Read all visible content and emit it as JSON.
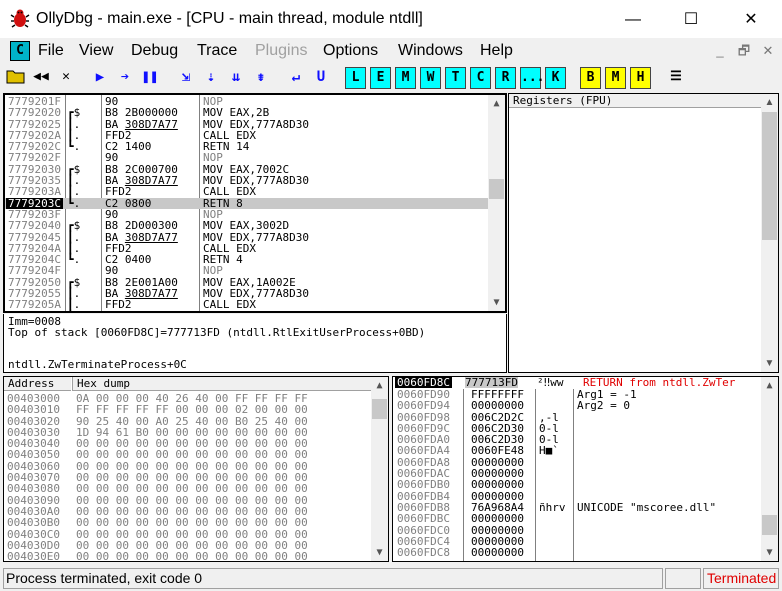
{
  "window": {
    "title": "OllyDbg - main.exe - [CPU - main thread, module ntdll]",
    "minimize": "—",
    "maximize": "☐",
    "close": "✕"
  },
  "menu": {
    "c_icon": "C",
    "items": [
      "File",
      "View",
      "Debug",
      "Trace",
      "Plugins",
      "Options",
      "Windows",
      "Help"
    ],
    "disabled": [
      "Plugins"
    ],
    "mdi": [
      "_",
      "🗗",
      "✕"
    ]
  },
  "toolbar": {
    "letters": [
      "L",
      "E",
      "M",
      "W",
      "T",
      "C",
      "R",
      "...",
      "K"
    ],
    "yellow": [
      "B",
      "M",
      "H"
    ]
  },
  "disasm": {
    "rows": [
      {
        "addr": "7779201F",
        "brace": "",
        "hex": "90",
        "cmd": "NOP",
        "nop": true
      },
      {
        "addr": "77792020",
        "brace": "┏$",
        "hex": "B8 2B000000",
        "cmd": "MOV EAX,2B"
      },
      {
        "addr": "77792025",
        "brace": "┃.",
        "hex": "BA 308D7A77",
        "cmd": "MOV EDX,777A8D30",
        "ul": true
      },
      {
        "addr": "7779202A",
        "brace": "┃.",
        "hex": "FFD2",
        "cmd": "CALL EDX"
      },
      {
        "addr": "7779202C",
        "brace": "┗.",
        "hex": "C2 1400",
        "cmd": "RETN 14"
      },
      {
        "addr": "7779202F",
        "brace": "",
        "hex": "90",
        "cmd": "NOP",
        "nop": true
      },
      {
        "addr": "77792030",
        "brace": "┏$",
        "hex": "B8 2C000700",
        "cmd": "MOV EAX,7002C"
      },
      {
        "addr": "77792035",
        "brace": "┃.",
        "hex": "BA 308D7A77",
        "cmd": "MOV EDX,777A8D30",
        "ul": true
      },
      {
        "addr": "7779203A",
        "brace": "┃.",
        "hex": "FFD2",
        "cmd": "CALL EDX"
      },
      {
        "addr": "7779203C",
        "brace": "┗.",
        "hex": "C2 0800",
        "cmd": "RETN 8",
        "sel": true
      },
      {
        "addr": "7779203F",
        "brace": "",
        "hex": "90",
        "cmd": "NOP",
        "nop": true
      },
      {
        "addr": "77792040",
        "brace": "┏$",
        "hex": "B8 2D000300",
        "cmd": "MOV EAX,3002D"
      },
      {
        "addr": "77792045",
        "brace": "┃.",
        "hex": "BA 308D7A77",
        "cmd": "MOV EDX,777A8D30",
        "ul": true
      },
      {
        "addr": "7779204A",
        "brace": "┃.",
        "hex": "FFD2",
        "cmd": "CALL EDX"
      },
      {
        "addr": "7779204C",
        "brace": "┗.",
        "hex": "C2 0400",
        "cmd": "RETN 4"
      },
      {
        "addr": "7779204F",
        "brace": "",
        "hex": "90",
        "cmd": "NOP",
        "nop": true
      },
      {
        "addr": "77792050",
        "brace": "┏$",
        "hex": "B8 2E001A00",
        "cmd": "MOV EAX,1A002E"
      },
      {
        "addr": "77792055",
        "brace": "┃.",
        "hex": "BA 308D7A77",
        "cmd": "MOV EDX,777A8D30",
        "ul": true
      },
      {
        "addr": "7779205A",
        "brace": "┃.",
        "hex": "FFD2",
        "cmd": "CALL EDX"
      },
      {
        "addr": "7779205C",
        "brace": "┗.",
        "hex": "C2 0400",
        "cmd": "RETN 4"
      }
    ]
  },
  "registers": {
    "header": "Registers (FPU)"
  },
  "info": {
    "line1": "Imm=0008",
    "line2": "Top of stack [0060FD8C]=777713FD (ntdll.RtlExitUserProcess+0BD)",
    "line3": "ntdll.ZwTerminateProcess+0C"
  },
  "dump": {
    "header_address": "Address",
    "header_hex": "Hex dump",
    "rows": [
      {
        "addr": "00403000",
        "hex": "0A 00 00 00 40 26 40 00 FF FF FF FF"
      },
      {
        "addr": "00403010",
        "hex": "FF FF FF FF FF 00 00 00 02 00 00 00"
      },
      {
        "addr": "00403020",
        "hex": "90 25 40 00 A0 25 40 00 B0 25 40 00"
      },
      {
        "addr": "00403030",
        "hex": "1D 94 61 B0 00 00 00 00 00 00 00 00"
      },
      {
        "addr": "00403040",
        "hex": "00 00 00 00 00 00 00 00 00 00 00 00"
      },
      {
        "addr": "00403050",
        "hex": "00 00 00 00 00 00 00 00 00 00 00 00"
      },
      {
        "addr": "00403060",
        "hex": "00 00 00 00 00 00 00 00 00 00 00 00"
      },
      {
        "addr": "00403070",
        "hex": "00 00 00 00 00 00 00 00 00 00 00 00"
      },
      {
        "addr": "00403080",
        "hex": "00 00 00 00 00 00 00 00 00 00 00 00"
      },
      {
        "addr": "00403090",
        "hex": "00 00 00 00 00 00 00 00 00 00 00 00"
      },
      {
        "addr": "004030A0",
        "hex": "00 00 00 00 00 00 00 00 00 00 00 00"
      },
      {
        "addr": "004030B0",
        "hex": "00 00 00 00 00 00 00 00 00 00 00 00"
      },
      {
        "addr": "004030C0",
        "hex": "00 00 00 00 00 00 00 00 00 00 00 00"
      },
      {
        "addr": "004030D0",
        "hex": "00 00 00 00 00 00 00 00 00 00 00 00"
      },
      {
        "addr": "004030E0",
        "hex": "00 00 00 00 00 00 00 00 00 00 00 00"
      }
    ]
  },
  "stack": {
    "header_addr": "0060FD8C",
    "header_val": "777713FD",
    "header_ascii": "²‼ww",
    "header_comment": "RETURN from ntdll.ZwTer",
    "rows": [
      {
        "addr": "0060FD90",
        "val": "FFFFFFFF",
        "ascii": "",
        "comment": "Arg1 = -1"
      },
      {
        "addr": "0060FD94",
        "val": "00000000",
        "ascii": "",
        "comment": "Arg2 = 0"
      },
      {
        "addr": "0060FD98",
        "val": "006C2D2C",
        "ascii": ",-l",
        "comment": ""
      },
      {
        "addr": "0060FD9C",
        "val": "006C2D30",
        "ascii": "0-l",
        "comment": ""
      },
      {
        "addr": "0060FDA0",
        "val": "006C2D30",
        "ascii": "0-l",
        "comment": ""
      },
      {
        "addr": "0060FDA4",
        "val": "0060FE48",
        "ascii": "H■`",
        "comment": ""
      },
      {
        "addr": "0060FDA8",
        "val": "00000000",
        "ascii": "",
        "comment": ""
      },
      {
        "addr": "0060FDAC",
        "val": "00000000",
        "ascii": "",
        "comment": ""
      },
      {
        "addr": "0060FDB0",
        "val": "00000000",
        "ascii": "",
        "comment": ""
      },
      {
        "addr": "0060FDB4",
        "val": "00000000",
        "ascii": "",
        "comment": ""
      },
      {
        "addr": "0060FDB8",
        "val": "76A968A4",
        "ascii": "ñhrv",
        "comment": "UNICODE \"mscoree.dll\""
      },
      {
        "addr": "0060FDBC",
        "val": "00000000",
        "ascii": "",
        "comment": ""
      },
      {
        "addr": "0060FDC0",
        "val": "00000000",
        "ascii": "",
        "comment": ""
      },
      {
        "addr": "0060FDC4",
        "val": "00000000",
        "ascii": "",
        "comment": ""
      },
      {
        "addr": "0060FDC8",
        "val": "00000000",
        "ascii": "",
        "comment": ""
      }
    ]
  },
  "status": {
    "message": "Process terminated, exit code 0",
    "state": "Terminated",
    "state_color": "#e00000"
  }
}
